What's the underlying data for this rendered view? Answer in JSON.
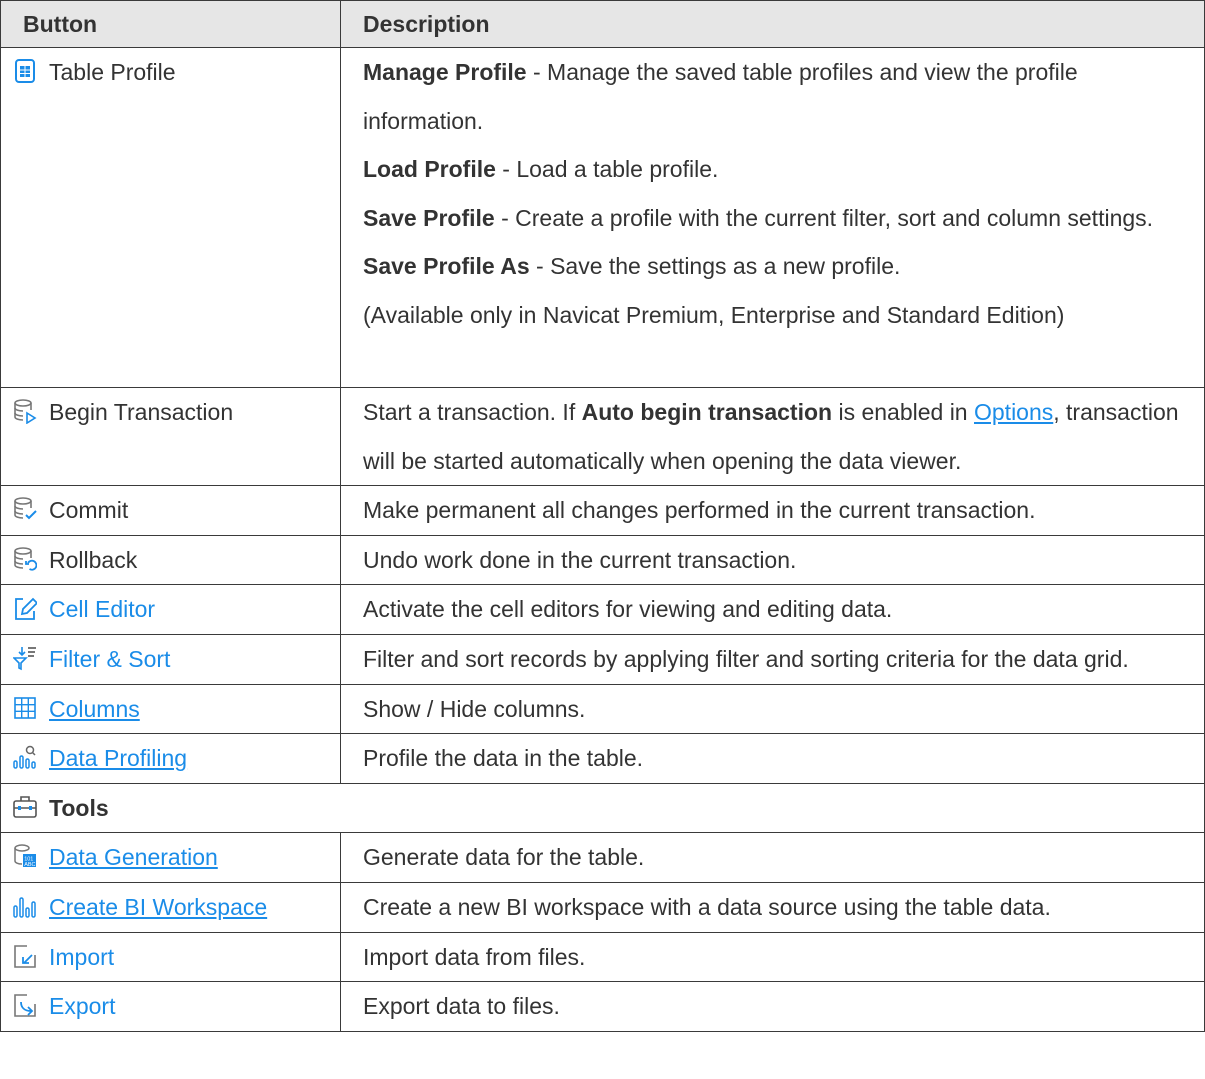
{
  "header": {
    "col1": "Button",
    "col2": "Description"
  },
  "rows": [
    {
      "label": "Table Profile",
      "icon": "table-profile-icon",
      "lines": [
        {
          "bold": "Manage Profile",
          "text": " - Manage the saved table profiles and view the profile information."
        },
        {
          "bold": "Load Profile",
          "text": " - Load a table profile."
        },
        {
          "bold": "Save Profile",
          "text": " - Create a profile with the current filter, sort and column settings."
        },
        {
          "bold": "Save Profile As",
          "text": " - Save the settings as a new profile."
        },
        {
          "bold": "",
          "text": "(Available only in Navicat Premium, Enterprise and Standard Edition)"
        }
      ]
    },
    {
      "label": "Begin Transaction",
      "icon": "begin-transaction-icon",
      "pre": "Start a transaction. If ",
      "bold": "Auto begin transaction",
      "mid": " is enabled in ",
      "link": "Options",
      "post": ", transaction will be started automatically when opening the data viewer."
    },
    {
      "label": "Commit",
      "icon": "commit-icon",
      "text": "Make permanent all changes performed in the current transaction."
    },
    {
      "label": "Rollback",
      "icon": "rollback-icon",
      "text": "Undo work done in the current transaction."
    },
    {
      "label": "Cell Editor",
      "icon": "cell-editor-icon",
      "text": "Activate the cell editors for viewing and editing data."
    },
    {
      "label": "Filter & Sort",
      "icon": "filter-sort-icon",
      "text": "Filter and sort records by applying filter and sorting criteria for the data grid."
    },
    {
      "label": "Columns",
      "icon": "columns-icon",
      "text": "Show / Hide columns."
    },
    {
      "label": "Data Profiling",
      "icon": "data-profiling-icon",
      "text": "Profile the data in the table."
    },
    {
      "label": "Tools",
      "icon": "toolbox-icon"
    },
    {
      "label": "Data Generation",
      "icon": "data-generation-icon",
      "text": "Generate data for the table."
    },
    {
      "label": "Create BI Workspace",
      "icon": "bi-workspace-icon",
      "text": "Create a new BI workspace with a data source using the table data."
    },
    {
      "label": "Import",
      "icon": "import-icon",
      "text": "Import data from files."
    },
    {
      "label": "Export",
      "icon": "export-icon",
      "text": "Export data to files."
    }
  ],
  "colors": {
    "link": "#1a8ce8",
    "header_bg": "#e6e6e6",
    "text": "#333333",
    "border": "#3a3a3a"
  }
}
